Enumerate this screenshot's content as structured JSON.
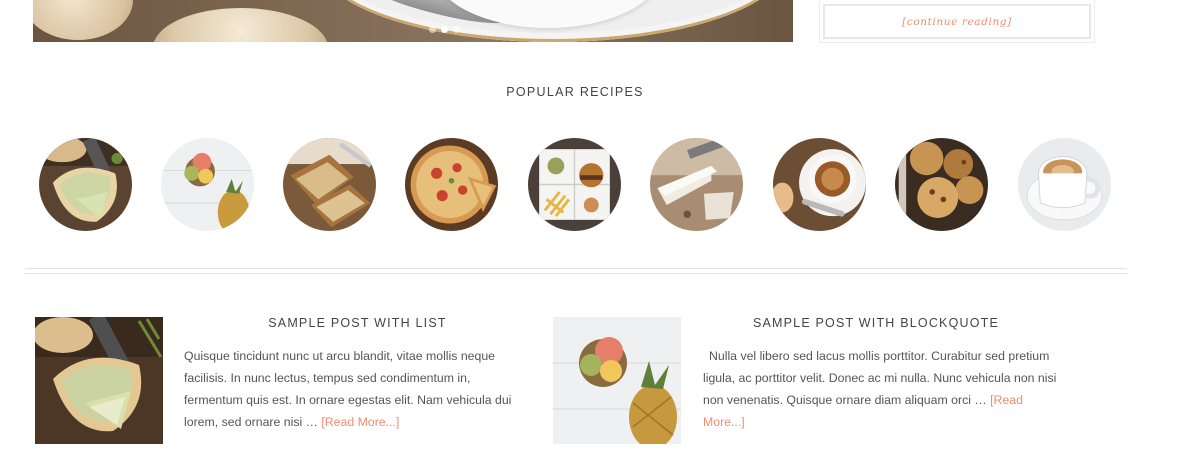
{
  "slider": {
    "dots": [
      {
        "state": "inactive"
      },
      {
        "state": "active"
      },
      {
        "state": "inactive"
      }
    ]
  },
  "sidebar": {
    "continue_reading": "[continue reading]"
  },
  "popular": {
    "title": "POPULAR RECIPES",
    "items": [
      {
        "icon": "quiche-thumbnail"
      },
      {
        "icon": "fruit-pineapple-thumbnail"
      },
      {
        "icon": "bread-thumbnail"
      },
      {
        "icon": "pizza-thumbnail"
      },
      {
        "icon": "burger-fries-thumbnail"
      },
      {
        "icon": "cheesecake-thumbnail"
      },
      {
        "icon": "onion-soup-thumbnail"
      },
      {
        "icon": "muffins-thumbnail"
      },
      {
        "icon": "coffee-cup-thumbnail"
      }
    ]
  },
  "posts": [
    {
      "title": "SAMPLE POST WITH LIST",
      "excerpt": "Quisque tincidunt nunc ut arcu blandit, vitae mollis neque facilisis. In nunc lectus, tempus sed condimentum in, fermentum quis est. In ornare egestas elit. Nam vehicula dui lorem, sed ornare nisi …",
      "read_more": "[Read More...]",
      "image": "quiche-image"
    },
    {
      "title": "SAMPLE POST WITH BLOCKQUOTE",
      "excerpt": "Nulla vel libero sed lacus mollis porttitor. Curabitur sed pretium ligula, ac porttitor velit. Donec ac mi nulla. Nunc vehicula non nisi non venenatis. Quisque ornare diam aliquam orci …",
      "read_more": "[Read More...]",
      "image": "fruit-pineapple-image"
    }
  ],
  "colors": {
    "accent": "#ef8c6c",
    "heading": "#444444",
    "text": "#555555",
    "divider": "#e4e4e4"
  }
}
